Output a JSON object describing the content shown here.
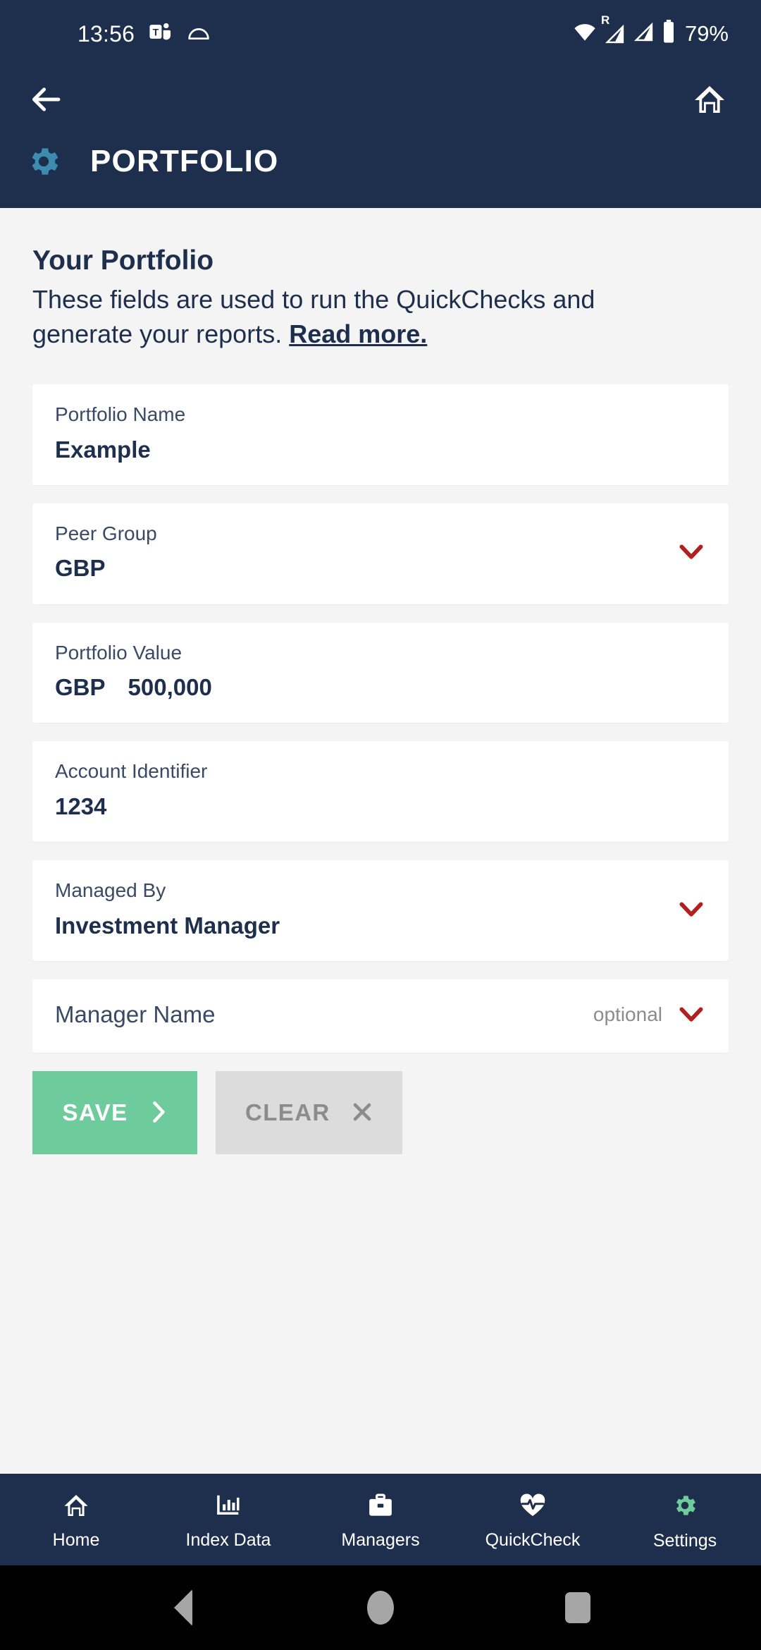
{
  "status_bar": {
    "time": "13:56",
    "battery_text": "79%",
    "roaming_label": "R",
    "icons": [
      "teams-icon",
      "cloud-icon",
      "wifi-icon",
      "signal-icon-1",
      "signal-icon-2",
      "battery-icon"
    ]
  },
  "app_bar": {
    "back_icon": "arrow-left-icon",
    "home_icon": "home-icon",
    "gear_icon": "gear-icon",
    "title": "PORTFOLIO",
    "background_color": "#1e2f4d",
    "gear_color": "#3d8bae"
  },
  "intro": {
    "heading": "Your Portfolio",
    "description": "These fields are used to run the QuickChecks and generate your reports.",
    "link_text": "Read more."
  },
  "fields": [
    {
      "label": "Portfolio Name",
      "value": "Example",
      "value_prefix": "",
      "has_chevron": false,
      "optional": "",
      "single_line": false
    },
    {
      "label": "Peer Group",
      "value": "GBP",
      "value_prefix": "",
      "has_chevron": true,
      "optional": "",
      "single_line": false
    },
    {
      "label": "Portfolio Value",
      "value": "500,000",
      "value_prefix": "GBP",
      "has_chevron": false,
      "optional": "",
      "single_line": false
    },
    {
      "label": "Account Identifier",
      "value": "1234",
      "value_prefix": "",
      "has_chevron": false,
      "optional": "",
      "single_line": false
    },
    {
      "label": "Managed By",
      "value": "Investment Manager",
      "value_prefix": "",
      "has_chevron": true,
      "optional": "",
      "single_line": false
    },
    {
      "label": "Manager Name",
      "value": "",
      "value_prefix": "",
      "has_chevron": true,
      "optional": "optional",
      "single_line": true
    }
  ],
  "buttons": {
    "save_label": "SAVE",
    "save_icon": "chevron-right-icon",
    "save_color": "#6ecb9b",
    "clear_label": "CLEAR",
    "clear_icon": "close-icon",
    "clear_color": "#dcdcdc"
  },
  "bottom_nav": {
    "active_color": "#6ecb9b",
    "items": [
      {
        "label": "Home",
        "icon": "home-icon",
        "active": false
      },
      {
        "label": "Index Data",
        "icon": "bar-chart-icon",
        "active": false
      },
      {
        "label": "Managers",
        "icon": "briefcase-icon",
        "active": false
      },
      {
        "label": "QuickCheck",
        "icon": "heart-pulse-icon",
        "active": false
      },
      {
        "label": "Settings",
        "icon": "gear-icon",
        "active": true
      }
    ]
  },
  "android_nav": {
    "back": "android-back-button",
    "home": "android-home-button",
    "recents": "android-recents-button"
  }
}
